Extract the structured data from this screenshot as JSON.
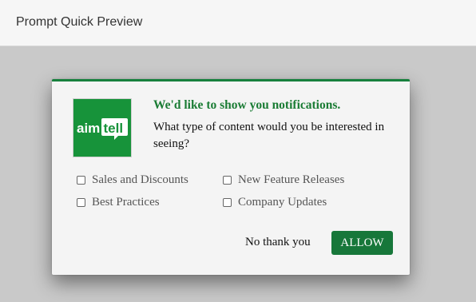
{
  "topbar": {
    "title": "Prompt Quick Preview"
  },
  "dialog": {
    "logo": {
      "text_part1": "aim",
      "text_part2": "tell",
      "bg_color": "#17933a"
    },
    "heading": "We'd like to show you notifications.",
    "question": "What type of content would you be interested in seeing?",
    "options": [
      {
        "label": "Sales and Discounts",
        "checked": false
      },
      {
        "label": "New Feature Releases",
        "checked": false
      },
      {
        "label": "Best Practices",
        "checked": false
      },
      {
        "label": "Company Updates",
        "checked": false
      }
    ],
    "no_thanks_label": "No thank you",
    "allow_label": "ALLOW",
    "accent_color": "#17803d"
  }
}
